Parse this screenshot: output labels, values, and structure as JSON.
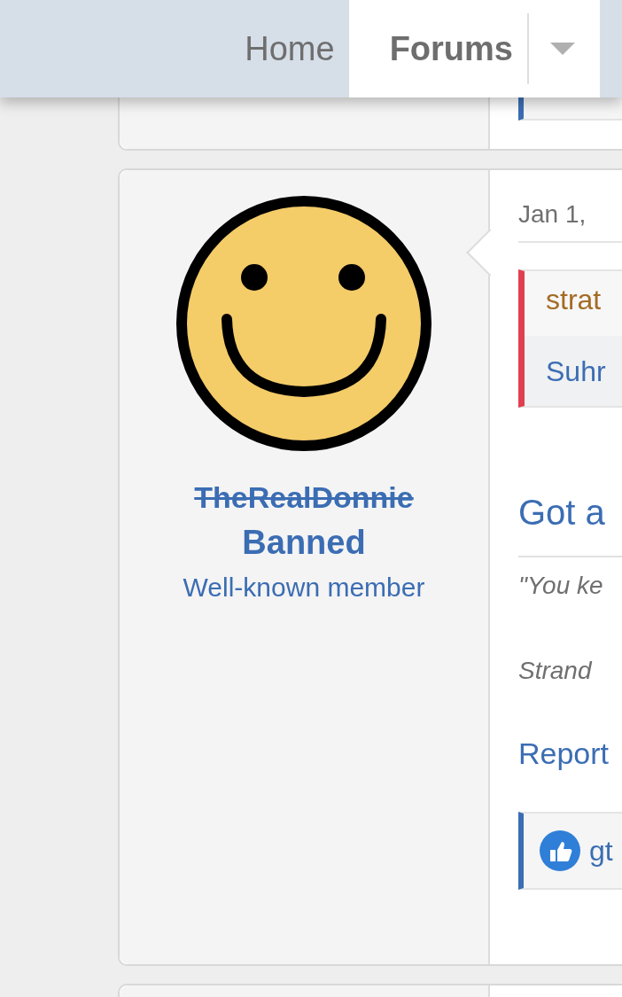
{
  "nav": {
    "tabs": [
      {
        "label": "Home",
        "selected": false
      },
      {
        "label": "Forums",
        "selected": true
      }
    ]
  },
  "post": {
    "user": {
      "name": "TheRealDonnie",
      "banned": true,
      "banner": "Banned",
      "title": "Well-known member"
    },
    "date": "Jan 1,",
    "quote": {
      "author": "strat",
      "text": "Suhr"
    },
    "heading": "Got a",
    "signature_lines": [
      "\"You ke",
      "Strand"
    ],
    "report": "Report",
    "reactions": "gt"
  }
}
